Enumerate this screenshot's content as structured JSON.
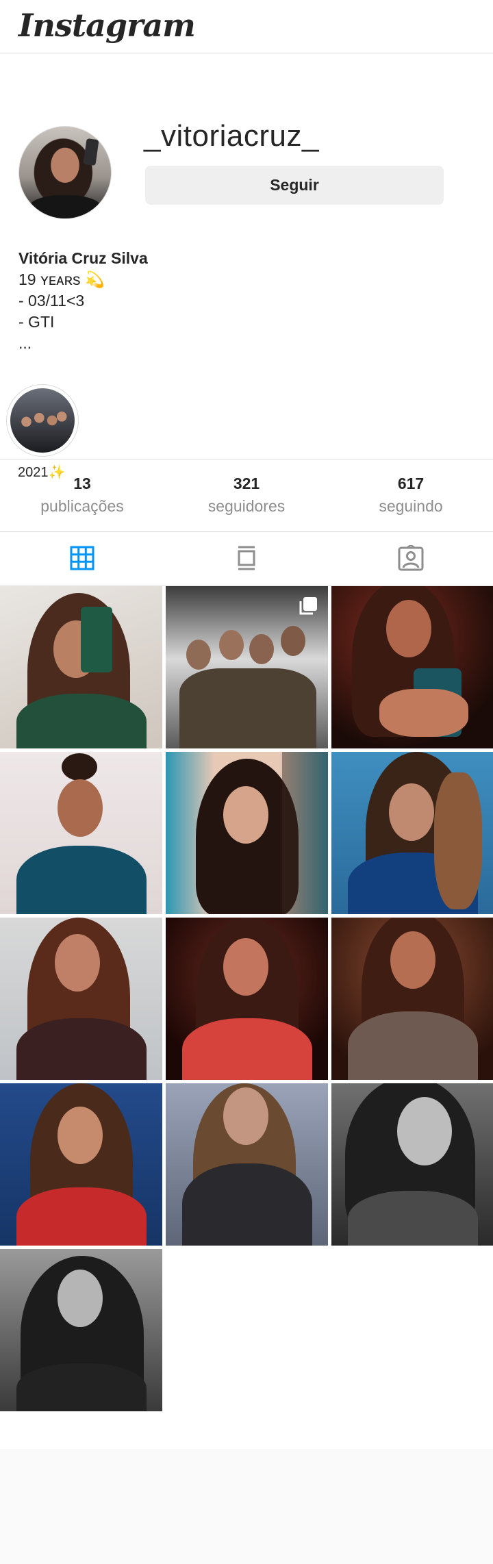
{
  "app": {
    "logo": "Instagram"
  },
  "profile": {
    "username": "_vitoriacruz_",
    "follow_label": "Seguir",
    "full_name": "Vitória Cruz Silva",
    "bio_lines": [
      "19 ʏᴇᴀʀs 💫",
      "- 03/11<3",
      "- GTI",
      "..."
    ]
  },
  "highlights": [
    {
      "label": "2021✨"
    }
  ],
  "stats": [
    {
      "value": "13",
      "label": "publicações"
    },
    {
      "value": "321",
      "label": "seguidores"
    },
    {
      "value": "617",
      "label": "seguindo"
    }
  ],
  "tabs": [
    {
      "icon": "grid-icon",
      "active": true
    },
    {
      "icon": "feed-icon",
      "active": false
    },
    {
      "icon": "tagged-icon",
      "active": false
    }
  ],
  "colors": {
    "accent": "#0095f6",
    "active_tab": "#0095f6",
    "inactive_tab": "#8e8e8e",
    "border": "#dbdbdb",
    "button_bg": "#efefef"
  },
  "posts": [
    {
      "index": 1,
      "multi": false
    },
    {
      "index": 2,
      "multi": true
    },
    {
      "index": 3,
      "multi": false
    },
    {
      "index": 4,
      "multi": false
    },
    {
      "index": 5,
      "multi": false
    },
    {
      "index": 6,
      "multi": false
    },
    {
      "index": 7,
      "multi": false
    },
    {
      "index": 8,
      "multi": false
    },
    {
      "index": 9,
      "multi": false
    },
    {
      "index": 10,
      "multi": false
    },
    {
      "index": 11,
      "multi": false
    },
    {
      "index": 12,
      "multi": false
    },
    {
      "index": 13,
      "multi": false
    }
  ]
}
